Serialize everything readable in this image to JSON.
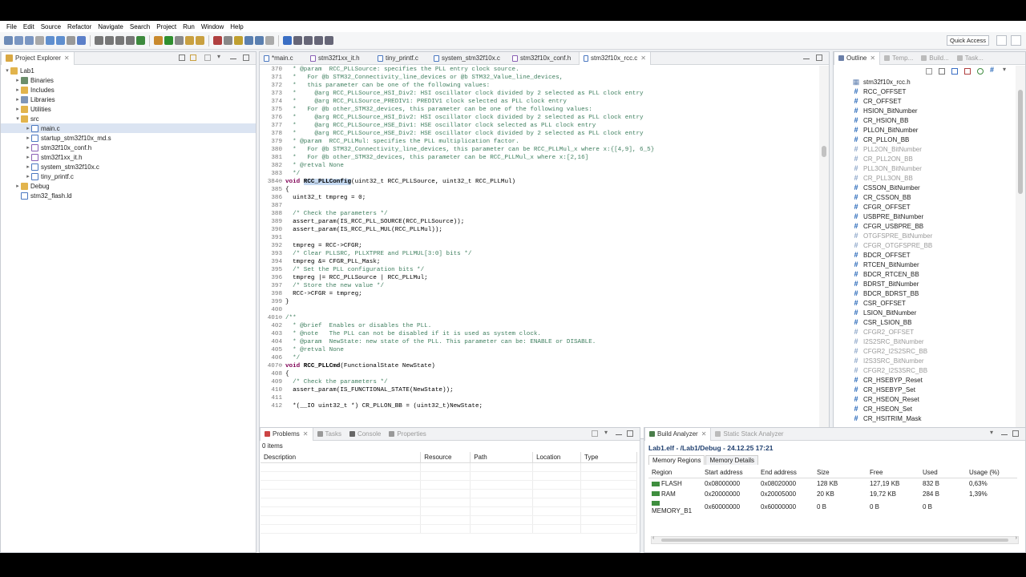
{
  "menu": [
    "File",
    "Edit",
    "Source",
    "Refactor",
    "Navigate",
    "Search",
    "Project",
    "Run",
    "Window",
    "Help"
  ],
  "quick_access": "Quick Access",
  "project_explorer": {
    "title": "Project Explorer",
    "items": [
      {
        "label": "Lab1",
        "depth": 0,
        "type": "project",
        "twisty": "▾"
      },
      {
        "label": "Binaries",
        "depth": 1,
        "type": "binaries",
        "twisty": "▸"
      },
      {
        "label": "Includes",
        "depth": 1,
        "type": "folder",
        "twisty": "▸"
      },
      {
        "label": "Libraries",
        "depth": 1,
        "type": "lib",
        "twisty": "▸"
      },
      {
        "label": "Utilities",
        "depth": 1,
        "type": "folder",
        "twisty": "▸"
      },
      {
        "label": "src",
        "depth": 1,
        "type": "folder",
        "twisty": "▾"
      },
      {
        "label": "main.c",
        "depth": 2,
        "type": "c",
        "twisty": "▸",
        "selected": true
      },
      {
        "label": "startup_stm32f10x_md.s",
        "depth": 2,
        "type": "s",
        "twisty": "▸"
      },
      {
        "label": "stm32f10x_conf.h",
        "depth": 2,
        "type": "h",
        "twisty": "▸"
      },
      {
        "label": "stm32f1xx_it.h",
        "depth": 2,
        "type": "h",
        "twisty": "▸"
      },
      {
        "label": "system_stm32f10x.c",
        "depth": 2,
        "type": "c",
        "twisty": "▸"
      },
      {
        "label": "tiny_printf.c",
        "depth": 2,
        "type": "c",
        "twisty": "▸"
      },
      {
        "label": "Debug",
        "depth": 1,
        "type": "folder",
        "twisty": "▸"
      },
      {
        "label": "stm32_flash.ld",
        "depth": 1,
        "type": "ld",
        "twisty": ""
      }
    ]
  },
  "editor": {
    "tabs": [
      "*main.c",
      "stm32f1xx_it.h",
      "tiny_printf.c",
      "system_stm32f10x.c",
      "stm32f10x_conf.h",
      "stm32f10x_rcc.c"
    ],
    "active_tab": 5,
    "lines": [
      {
        "n": "370",
        "t": "  * @param  RCC_PLLSource: specifies the PLL entry clock source.",
        "c": "cm"
      },
      {
        "n": "371",
        "t": "  *   For @b STM32_Connectivity_line_devices or @b STM32_Value_line_devices,",
        "c": "cm"
      },
      {
        "n": "372",
        "t": "  *   this parameter can be one of the following values:",
        "c": "cm"
      },
      {
        "n": "373",
        "t": "  *     @arg RCC_PLLSource_HSI_Div2: HSI oscillator clock divided by 2 selected as PLL clock entry",
        "c": "cm"
      },
      {
        "n": "374",
        "t": "  *     @arg RCC_PLLSource_PREDIV1: PREDIV1 clock selected as PLL clock entry",
        "c": "cm"
      },
      {
        "n": "375",
        "t": "  *   For @b other_STM32_devices, this parameter can be one of the following values:",
        "c": "cm"
      },
      {
        "n": "376",
        "t": "  *     @arg RCC_PLLSource_HSI_Div2: HSI oscillator clock divided by 2 selected as PLL clock entry",
        "c": "cm"
      },
      {
        "n": "377",
        "t": "  *     @arg RCC_PLLSource_HSE_Div1: HSE oscillator clock selected as PLL clock entry",
        "c": "cm"
      },
      {
        "n": "378",
        "t": "  *     @arg RCC_PLLSource_HSE_Div2: HSE oscillator clock divided by 2 selected as PLL clock entry",
        "c": "cm"
      },
      {
        "n": "379",
        "t": "  * @param  RCC_PLLMul: specifies the PLL multiplication factor.",
        "c": "cm"
      },
      {
        "n": "380",
        "t": "  *   For @b STM32_Connectivity_line_devices, this parameter can be RCC_PLLMul_x where x:{[4,9], 6_5}",
        "c": "cm"
      },
      {
        "n": "381",
        "t": "  *   For @b other_STM32_devices, this parameter can be RCC_PLLMul_x where x:[2,16]",
        "c": "cm"
      },
      {
        "n": "382",
        "t": "  * @retval None",
        "c": "cm"
      },
      {
        "n": "383",
        "t": "  */",
        "c": "cm"
      },
      {
        "n": "384⊖",
        "t": "void RCC_PLLConfig(uint32_t RCC_PLLSource, uint32_t RCC_PLLMul)",
        "c": "fn",
        "hl": "RCC_PLLConfig"
      },
      {
        "n": "385",
        "t": "{",
        "c": ""
      },
      {
        "n": "386",
        "t": "  uint32_t tmpreg = 0;",
        "c": ""
      },
      {
        "n": "387",
        "t": "",
        "c": ""
      },
      {
        "n": "388",
        "t": "  /* Check the parameters */",
        "c": "cm"
      },
      {
        "n": "389",
        "t": "  assert_param(IS_RCC_PLL_SOURCE(RCC_PLLSource));",
        "c": ""
      },
      {
        "n": "390",
        "t": "  assert_param(IS_RCC_PLL_MUL(RCC_PLLMul));",
        "c": ""
      },
      {
        "n": "391",
        "t": "",
        "c": ""
      },
      {
        "n": "392",
        "t": "  tmpreg = RCC->CFGR;",
        "c": ""
      },
      {
        "n": "393",
        "t": "  /* Clear PLLSRC, PLLXTPRE and PLLMUL[3:0] bits */",
        "c": "cm"
      },
      {
        "n": "394",
        "t": "  tmpreg &= CFGR_PLL_Mask;",
        "c": ""
      },
      {
        "n": "395",
        "t": "  /* Set the PLL configuration bits */",
        "c": "cm"
      },
      {
        "n": "396",
        "t": "  tmpreg |= RCC_PLLSource | RCC_PLLMul;",
        "c": ""
      },
      {
        "n": "397",
        "t": "  /* Store the new value */",
        "c": "cm"
      },
      {
        "n": "398",
        "t": "  RCC->CFGR = tmpreg;",
        "c": ""
      },
      {
        "n": "399",
        "t": "}",
        "c": ""
      },
      {
        "n": "400",
        "t": "",
        "c": ""
      },
      {
        "n": "401⊖",
        "t": "/**",
        "c": "cm"
      },
      {
        "n": "402",
        "t": "  * @brief  Enables or disables the PLL.",
        "c": "cm"
      },
      {
        "n": "403",
        "t": "  * @note   The PLL can not be disabled if it is used as system clock.",
        "c": "cm"
      },
      {
        "n": "404",
        "t": "  * @param  NewState: new state of the PLL. This parameter can be: ENABLE or DISABLE.",
        "c": "cm"
      },
      {
        "n": "405",
        "t": "  * @retval None",
        "c": "cm"
      },
      {
        "n": "406",
        "t": "  */",
        "c": "cm"
      },
      {
        "n": "407⊖",
        "t": "void RCC_PLLCmd(FunctionalState NewState)",
        "c": "fn2"
      },
      {
        "n": "408",
        "t": "{",
        "c": ""
      },
      {
        "n": "409",
        "t": "  /* Check the parameters */",
        "c": "cm"
      },
      {
        "n": "410",
        "t": "  assert_param(IS_FUNCTIONAL_STATE(NewState));",
        "c": ""
      },
      {
        "n": "411",
        "t": "",
        "c": ""
      },
      {
        "n": "412",
        "t": "  *(__IO uint32_t *) CR_PLLON_BB = (uint32_t)NewState;",
        "c": ""
      }
    ]
  },
  "outline": {
    "tabs": [
      "Outline",
      "Temp...",
      "Build...",
      "Task..."
    ],
    "items": [
      {
        "label": "stm32f10x_rcc.h",
        "kind": "include"
      },
      {
        "label": "RCC_OFFSET",
        "kind": "def"
      },
      {
        "label": "CR_OFFSET",
        "kind": "def"
      },
      {
        "label": "HSION_BitNumber",
        "kind": "def"
      },
      {
        "label": "CR_HSION_BB",
        "kind": "def"
      },
      {
        "label": "PLLON_BitNumber",
        "kind": "def"
      },
      {
        "label": "CR_PLLON_BB",
        "kind": "def"
      },
      {
        "label": "PLL2ON_BitNumber",
        "kind": "grey"
      },
      {
        "label": "CR_PLL2ON_BB",
        "kind": "grey"
      },
      {
        "label": "PLL3ON_BitNumber",
        "kind": "grey"
      },
      {
        "label": "CR_PLL3ON_BB",
        "kind": "grey"
      },
      {
        "label": "CSSON_BitNumber",
        "kind": "def"
      },
      {
        "label": "CR_CSSON_BB",
        "kind": "def"
      },
      {
        "label": "CFGR_OFFSET",
        "kind": "def"
      },
      {
        "label": "USBPRE_BitNumber",
        "kind": "def"
      },
      {
        "label": "CFGR_USBPRE_BB",
        "kind": "def"
      },
      {
        "label": "OTGFSPRE_BitNumber",
        "kind": "grey"
      },
      {
        "label": "CFGR_OTGFSPRE_BB",
        "kind": "grey"
      },
      {
        "label": "BDCR_OFFSET",
        "kind": "def"
      },
      {
        "label": "RTCEN_BitNumber",
        "kind": "def"
      },
      {
        "label": "BDCR_RTCEN_BB",
        "kind": "def"
      },
      {
        "label": "BDRST_BitNumber",
        "kind": "def"
      },
      {
        "label": "BDCR_BDRST_BB",
        "kind": "def"
      },
      {
        "label": "CSR_OFFSET",
        "kind": "def"
      },
      {
        "label": "LSION_BitNumber",
        "kind": "def"
      },
      {
        "label": "CSR_LSION_BB",
        "kind": "def"
      },
      {
        "label": "CFGR2_OFFSET",
        "kind": "grey"
      },
      {
        "label": "I2S2SRC_BitNumber",
        "kind": "grey"
      },
      {
        "label": "CFGR2_I2S2SRC_BB",
        "kind": "grey"
      },
      {
        "label": "I2S3SRC_BitNumber",
        "kind": "grey"
      },
      {
        "label": "CFGR2_I2S3SRC_BB",
        "kind": "grey"
      },
      {
        "label": "CR_HSEBYP_Reset",
        "kind": "def"
      },
      {
        "label": "CR_HSEBYP_Set",
        "kind": "def"
      },
      {
        "label": "CR_HSEON_Reset",
        "kind": "def"
      },
      {
        "label": "CR_HSEON_Set",
        "kind": "def"
      },
      {
        "label": "CR_HSITRIM_Mask",
        "kind": "def"
      }
    ]
  },
  "problems": {
    "tabs": [
      "Problems",
      "Tasks",
      "Console",
      "Properties"
    ],
    "count": "0 items",
    "columns": [
      "Description",
      "Resource",
      "Path",
      "Location",
      "Type"
    ]
  },
  "build_analyzer": {
    "tabs": [
      "Build Analyzer",
      "Static Stack Analyzer"
    ],
    "heading": "Lab1.elf - /Lab1/Debug - 24.12.25 17:21",
    "subtabs": [
      "Memory Regions",
      "Memory Details"
    ],
    "columns": [
      "Region",
      "Start address",
      "End address",
      "Size",
      "Free",
      "Used",
      "Usage (%)"
    ],
    "rows": [
      [
        "FLASH",
        "0x08000000",
        "0x08020000",
        "128 KB",
        "127,19 KB",
        "832 B",
        "0,63%"
      ],
      [
        "RAM",
        "0x20000000",
        "0x20005000",
        "20 KB",
        "19,72 KB",
        "284 B",
        "1,39%"
      ],
      [
        "MEMORY_B1",
        "0x60000000",
        "0x60000000",
        "0 B",
        "0 B",
        "0 B",
        ""
      ]
    ]
  }
}
